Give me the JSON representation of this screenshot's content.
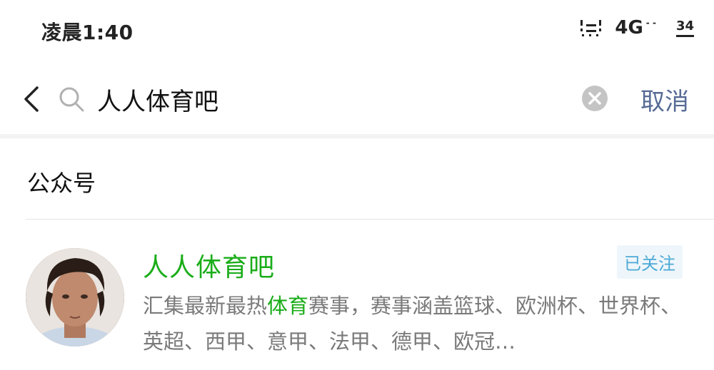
{
  "status_bar": {
    "time": "凌晨1:40",
    "network": "4G",
    "battery": "34"
  },
  "search": {
    "query": "人人体育吧",
    "cancel_label": "取消"
  },
  "section": {
    "title": "公众号"
  },
  "result": {
    "name": "人人体育吧",
    "badge": "已关注",
    "description_before": "汇集最新最热",
    "description_highlight": "体育",
    "description_after": "赛事，赛事涵盖篮球、欧洲杯、世界杯、英超、西甲、意甲、法甲、德甲、欧冠…"
  },
  "colors": {
    "accent_green": "#1aad19",
    "link_blue": "#576b95",
    "badge_blue": "#4da9d6"
  },
  "icons": [
    "back-icon",
    "search-icon",
    "clear-icon",
    "signal-icon"
  ]
}
